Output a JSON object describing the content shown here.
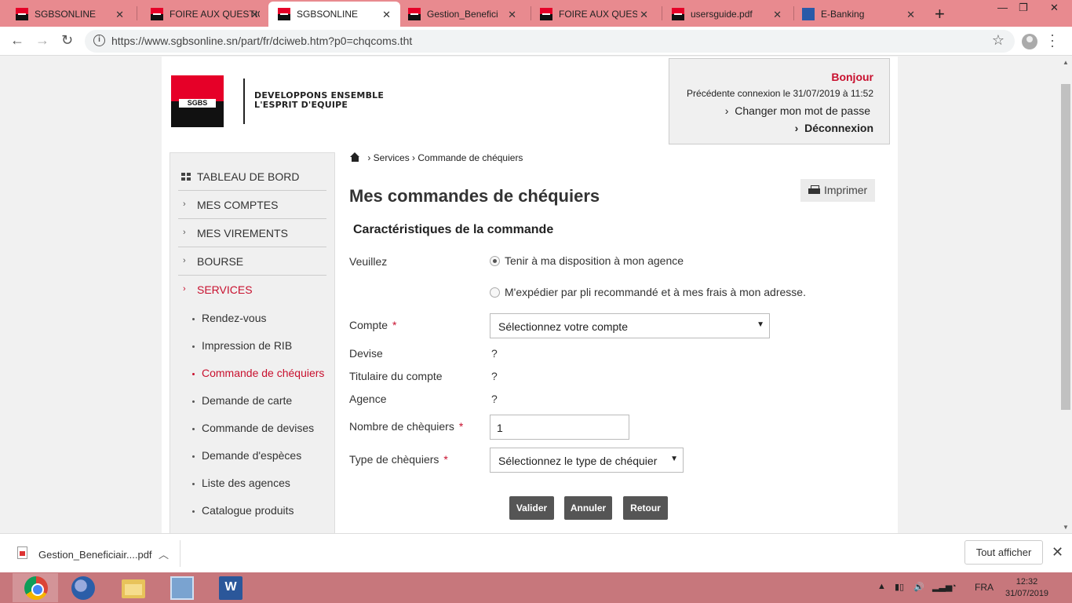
{
  "browser": {
    "tabs": [
      {
        "title": "SGBSONLINE",
        "icon": "sgbs-favicon",
        "active": false
      },
      {
        "title": "FOIRE AUX QUESTIONS",
        "icon": "sgbs-favicon",
        "active": false
      },
      {
        "title": "SGBSONLINE",
        "icon": "sgbs-favicon",
        "active": true
      },
      {
        "title": "Gestion_Beneficiaires",
        "icon": "sgbs-favicon",
        "active": false
      },
      {
        "title": "FOIRE AUX QUESTIONS",
        "icon": "sgbs-favicon",
        "active": false
      },
      {
        "title": "usersguide.pdf",
        "icon": "sgbs-favicon",
        "active": false
      },
      {
        "title": "E-Banking",
        "icon": "ebanking-favicon",
        "active": false
      }
    ],
    "url": "https://www.sgbsonline.sn/part/fr/dciweb.htm?p0=chqcoms.tht"
  },
  "header": {
    "logo_text": "SGBS",
    "slogan_line1": "DEVELOPPONS ENSEMBLE",
    "slogan_line2": "L'ESPRIT D'EQUIPE",
    "greeting": "Bonjour",
    "last_login": "Précédente connexion  le 31/07/2019 à 11:52",
    "change_password": "Changer mon mot de passe",
    "logout": "Déconnexion"
  },
  "sidebar": {
    "items": [
      {
        "label": "TABLEAU DE BORD"
      },
      {
        "label": "MES COMPTES"
      },
      {
        "label": "MES VIREMENTS"
      },
      {
        "label": "BOURSE"
      },
      {
        "label": "SERVICES"
      }
    ],
    "subitems": [
      {
        "label": "Rendez-vous"
      },
      {
        "label": "Impression de RIB"
      },
      {
        "label": "Commande de chéquiers"
      },
      {
        "label": "Demande de carte"
      },
      {
        "label": "Commande de devises"
      },
      {
        "label": "Demande d'espèces"
      },
      {
        "label": "Liste des agences"
      },
      {
        "label": "Catalogue produits"
      }
    ]
  },
  "breadcrumb": {
    "level1": "› Services",
    "level2": "› Commande de chéquiers"
  },
  "main": {
    "title": "Mes commandes de chéquiers",
    "print_label": "Imprimer",
    "section_title": "Caractéristiques de la commande",
    "form": {
      "veuillez_label": "Veuillez",
      "option1": "Tenir à ma disposition à mon agence",
      "option2": "M'expédier par pli recommandé et à mes frais à mon adresse.",
      "compte_label": "Compte",
      "compte_value": "Sélectionnez votre compte",
      "devise_label": "Devise",
      "devise_value": "?",
      "titulaire_label": "Titulaire du compte",
      "titulaire_value": "?",
      "agence_label": "Agence",
      "agence_value": "?",
      "nombre_label": "Nombre de chèquiers",
      "nombre_value": "1",
      "type_label": "Type de chèquiers",
      "type_value": "Sélectionnez le type de chéquier",
      "required_mark": "*"
    },
    "buttons": {
      "validate": "Valider",
      "cancel": "Annuler",
      "back": "Retour"
    }
  },
  "download_bar": {
    "file": "Gestion_Beneficiair....pdf",
    "show_all": "Tout afficher"
  },
  "taskbar": {
    "apps": [
      "chrome-icon",
      "thunderbird-icon",
      "file-explorer-icon",
      "remote-desktop-icon",
      "word-icon"
    ],
    "language": "FRA",
    "time": "12:32",
    "date": "31/07/2019"
  },
  "colors": {
    "brand_red": "#c8102e",
    "tab_strip": "#e88a8f",
    "taskbar": "#c7777c"
  }
}
